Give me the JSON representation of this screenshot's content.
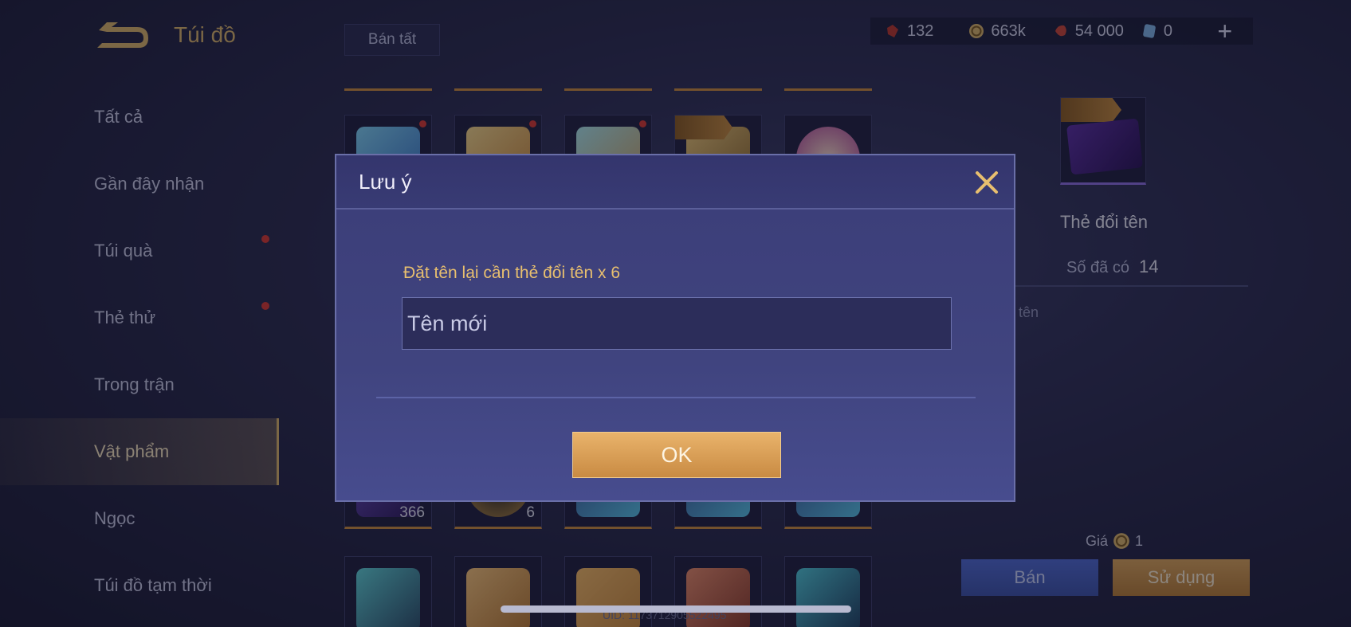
{
  "header": {
    "title": "Túi đồ",
    "sell_all": "Bán tất"
  },
  "currencies": [
    {
      "icon": "ruby-icon",
      "value": "132"
    },
    {
      "icon": "gold-coin-icon",
      "value": "663k"
    },
    {
      "icon": "red-gem-icon",
      "value": "54 000"
    },
    {
      "icon": "voucher-icon",
      "value": "0"
    }
  ],
  "sidebar": {
    "items": [
      {
        "label": "Tất cả",
        "badge": false
      },
      {
        "label": "Gần đây nhận",
        "badge": false
      },
      {
        "label": "Túi quà",
        "badge": true
      },
      {
        "label": "Thẻ thử",
        "badge": true
      },
      {
        "label": "Trong trận",
        "badge": false
      },
      {
        "label": "Vật phẩm",
        "badge": false,
        "active": true
      },
      {
        "label": "Ngọc",
        "badge": false
      },
      {
        "label": "Túi đồ tạm thời",
        "badge": false
      }
    ]
  },
  "grid": {
    "row2_counts": [
      "366",
      "6"
    ]
  },
  "detail": {
    "name": "Thẻ đổi tên",
    "owned_label": "Số đã có",
    "owned_value": "14",
    "desc_fragment": "tên",
    "price_label": "Giá",
    "price_value": "1",
    "sell_button": "Bán",
    "use_button": "Sử dụng"
  },
  "uid": "UID: 1173712905522495",
  "dialog": {
    "title": "Lưu ý",
    "message": "Đặt tên lại cần thẻ đổi tên x 6",
    "input_placeholder": "Tên mới",
    "ok_button": "OK"
  },
  "colors": {
    "accent_gold": "#d7b26b",
    "dialog_bg": "#3f4280",
    "ok_button": "#e0a65b",
    "badge_red": "#d63a34"
  }
}
